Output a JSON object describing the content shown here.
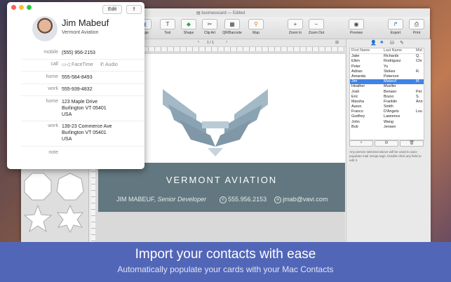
{
  "window": {
    "title": "businesscard",
    "subtitle": "— Edited"
  },
  "toolbar": {
    "items": [
      {
        "label": "Image",
        "icon": "image-icon"
      },
      {
        "label": "Text",
        "icon": "text-icon",
        "glyph": "T"
      },
      {
        "label": "Shape",
        "icon": "shape-icon",
        "glyph": "◆"
      },
      {
        "label": "Clip Art",
        "icon": "clipart-icon",
        "glyph": "✂"
      },
      {
        "label": "QR/Barcode",
        "icon": "qr-icon",
        "glyph": "▦"
      },
      {
        "label": "Map",
        "icon": "map-pin-icon",
        "glyph": "⚲"
      },
      {
        "label": "Zoom In",
        "icon": "zoom-in-icon",
        "glyph": "+"
      },
      {
        "label": "Zoom Out",
        "icon": "zoom-out-icon",
        "glyph": "−"
      },
      {
        "label": "Preview",
        "icon": "eye-icon",
        "glyph": "◉"
      },
      {
        "label": "Export",
        "icon": "export-icon",
        "glyph": "↱"
      },
      {
        "label": "Print",
        "icon": "printer-icon",
        "glyph": "⎙"
      }
    ]
  },
  "subbar": {
    "page": "1 / 1"
  },
  "card": {
    "company": "VERMONT AVIATION",
    "name": "JIM MABEUF,",
    "role": "Senior Developer",
    "phone": "555.956.2153",
    "email": "jmab@vavi.com",
    "colors": {
      "band": "#62777f",
      "logo_light": "#a3b9c6",
      "logo_dark": "#7f97a6"
    }
  },
  "contacts_panel": {
    "headers": [
      "First Name",
      "Last Name",
      "Mid"
    ],
    "rows": [
      [
        "Jake",
        "Richards",
        "Q."
      ],
      [
        "Ellen",
        "Rodriguez",
        "Chr"
      ],
      [
        "Peter",
        "Yu",
        ""
      ],
      [
        "Adrian",
        "Stokes",
        "R."
      ],
      [
        "Amanda",
        "Peterson",
        ""
      ],
      [
        "Jim",
        "Mabeuf",
        "M."
      ],
      [
        "Heather",
        "Mueller",
        ""
      ],
      [
        "Josh",
        "Bensen",
        "Pet"
      ],
      [
        "Eric",
        "Bruno",
        "S."
      ],
      [
        "Marsha",
        "Franklin",
        "Ann"
      ],
      [
        "Aaron",
        "Smith",
        ""
      ],
      [
        "Franco",
        "D'Angelo",
        "Lou"
      ],
      [
        "Godfrey",
        "Lawrence",
        ""
      ],
      [
        "John",
        "Wang",
        ""
      ],
      [
        "Bob",
        "Jensen",
        ""
      ]
    ],
    "selected_index": 5,
    "help": "Any person selected above will be used to auto-populate mail merge tags. Double-click any field to edit it."
  },
  "popover": {
    "name": "Jim Mabeuf",
    "org": "Vermont Aviation",
    "edit_label": "Edit",
    "fields": {
      "mobile_label": "mobile",
      "mobile": "(555) 956-2153",
      "call_label": "call",
      "facetime": "FaceTime",
      "audio": "Audio",
      "home_label": "home",
      "home_phone": "555-584-8493",
      "work_label": "work",
      "work_phone": "555-939-4832",
      "home_addr_label": "home",
      "home_addr1": "123 Maple Drive",
      "home_addr2": "Burlington VT 05401",
      "home_addr3": "USA",
      "work_addr_label": "work",
      "work_addr1": "139-23 Commerce Ave",
      "work_addr2": "Burlington VT 05401",
      "work_addr3": "USA",
      "note_label": "note"
    }
  },
  "banner": {
    "headline": "Import your contacts with ease",
    "subline": "Automatically populate your cards with your Mac Contacts",
    "color": "#5266b7"
  }
}
